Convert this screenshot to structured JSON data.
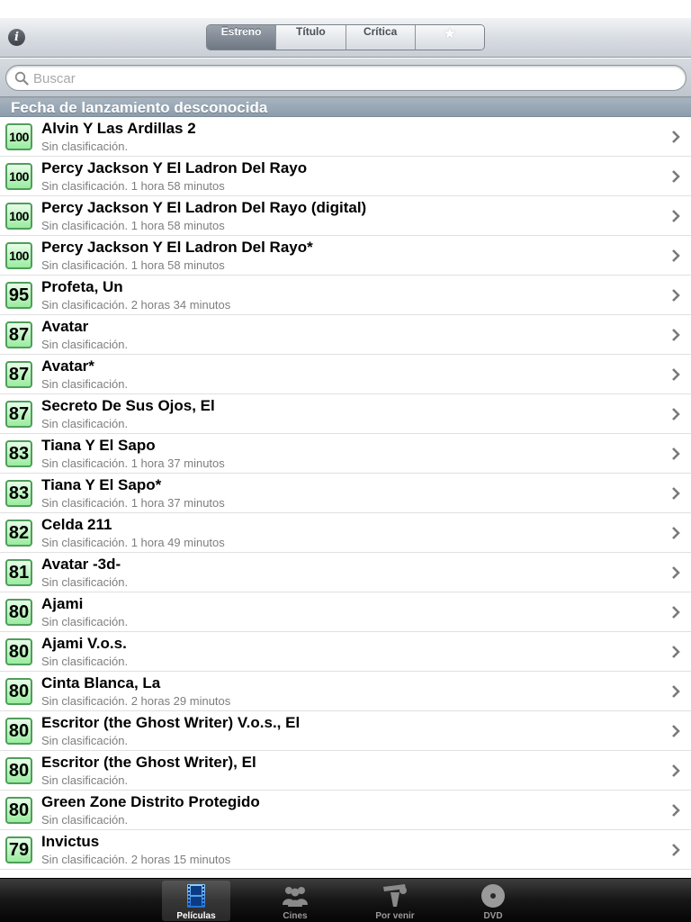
{
  "navbar": {
    "segments": [
      "Estreno",
      "Título",
      "Crítica",
      "★"
    ],
    "selected_segment": "Estreno"
  },
  "search": {
    "placeholder": "Buscar"
  },
  "section": {
    "header": "Fecha de lanzamiento desconocida"
  },
  "colors": {
    "score_fill": "#99ec9f",
    "score_border": "#4f9e5a",
    "section_header": "#97a6b4",
    "tabbar": "#161616"
  },
  "movies": [
    {
      "score": "100",
      "title": "Alvin Y Las Ardillas 2",
      "info": "Sin clasificación."
    },
    {
      "score": "100",
      "title": "Percy Jackson Y El Ladron Del Rayo",
      "info": "Sin clasificación. 1 hora 58 minutos"
    },
    {
      "score": "100",
      "title": "Percy Jackson Y El Ladron Del Rayo (digital)",
      "info": "Sin clasificación. 1 hora 58 minutos"
    },
    {
      "score": "100",
      "title": "Percy Jackson Y El Ladron Del Rayo*",
      "info": "Sin clasificación. 1 hora 58 minutos"
    },
    {
      "score": "95",
      "title": "Profeta, Un",
      "info": "Sin clasificación. 2 horas 34 minutos"
    },
    {
      "score": "87",
      "title": "Avatar",
      "info": "Sin clasificación."
    },
    {
      "score": "87",
      "title": "Avatar*",
      "info": "Sin clasificación."
    },
    {
      "score": "87",
      "title": "Secreto De Sus Ojos, El",
      "info": "Sin clasificación."
    },
    {
      "score": "83",
      "title": "Tiana Y El Sapo",
      "info": "Sin clasificación. 1 hora 37 minutos"
    },
    {
      "score": "83",
      "title": "Tiana Y El Sapo*",
      "info": "Sin clasificación. 1 hora 37 minutos"
    },
    {
      "score": "82",
      "title": "Celda 211",
      "info": "Sin clasificación. 1 hora 49 minutos"
    },
    {
      "score": "81",
      "title": "Avatar -3d-",
      "info": "Sin clasificación."
    },
    {
      "score": "80",
      "title": "Ajami",
      "info": "Sin clasificación."
    },
    {
      "score": "80",
      "title": "Ajami V.o.s.",
      "info": "Sin clasificación."
    },
    {
      "score": "80",
      "title": "Cinta Blanca, La",
      "info": "Sin clasificación. 2 horas 29 minutos"
    },
    {
      "score": "80",
      "title": "Escritor (the Ghost Writer) V.o.s., El",
      "info": "Sin clasificación."
    },
    {
      "score": "80",
      "title": "Escritor (the Ghost Writer), El",
      "info": "Sin clasificación."
    },
    {
      "score": "80",
      "title": "Green Zone Distrito Protegido",
      "info": "Sin clasificación."
    },
    {
      "score": "79",
      "title": "Invictus",
      "info": "Sin clasificación. 2 horas 15 minutos"
    }
  ],
  "tabbar": {
    "tabs": [
      {
        "label": "Películas",
        "icon": "film-icon",
        "active": true
      },
      {
        "label": "Cines",
        "icon": "people-icon",
        "active": false
      },
      {
        "label": "Por venir",
        "icon": "clapper-icon",
        "active": false
      },
      {
        "label": "DVD",
        "icon": "disc-icon",
        "active": false
      }
    ]
  }
}
